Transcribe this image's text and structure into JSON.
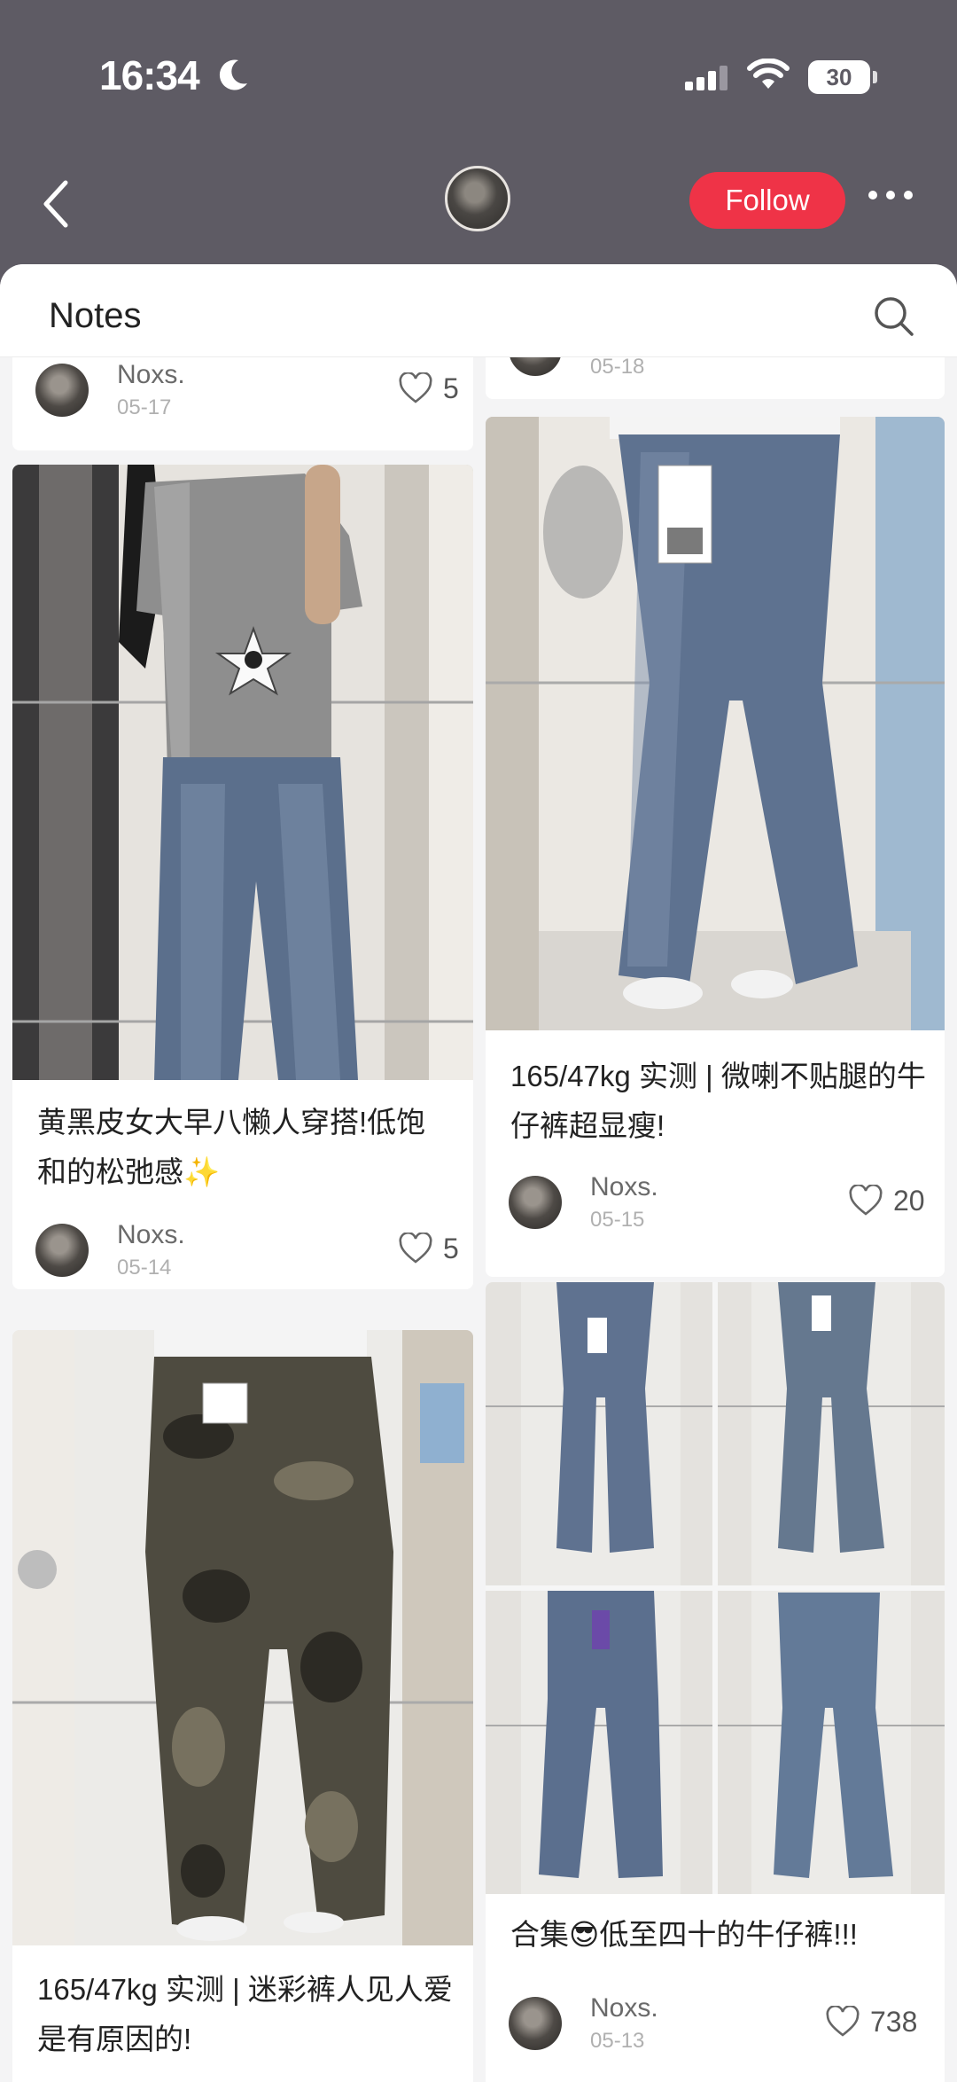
{
  "status_bar": {
    "time": "16:34",
    "battery": "30"
  },
  "nav": {
    "follow_label": "Follow"
  },
  "sheet": {
    "title": "Notes"
  },
  "notes": [
    {
      "id": "n0",
      "user": "Noxs.",
      "date": "05-17",
      "likes": "5"
    },
    {
      "id": "n1",
      "user": "Noxs.",
      "date": "05-18"
    },
    {
      "id": "n2",
      "title": "黄黑皮女大早八懒人穿搭!低饱和的松弛感✨",
      "user": "Noxs.",
      "date": "05-14",
      "likes": "5"
    },
    {
      "id": "n3",
      "title": "165/47kg 实测 | 微喇不贴腿的牛仔裤超显瘦!",
      "user": "Noxs.",
      "date": "05-15",
      "likes": "20"
    },
    {
      "id": "n4",
      "title": "165/47kg 实测 | 迷彩裤人见人爱是有原因的!"
    },
    {
      "id": "n5",
      "title": "合集😎低至四十的牛仔裤!!!",
      "user": "Noxs.",
      "date": "05-13",
      "likes": "738"
    }
  ],
  "colors": {
    "accent": "#ef3347",
    "header_bg": "#5e5b64",
    "sheet_bg": "#f4f4f5"
  },
  "icons": [
    "moon-icon",
    "signal-icon",
    "wifi-icon",
    "battery-icon",
    "back-icon",
    "more-icon",
    "search-icon",
    "heart-icon"
  ]
}
